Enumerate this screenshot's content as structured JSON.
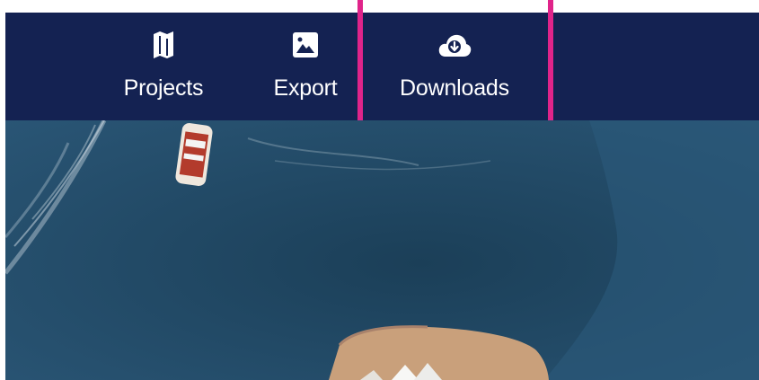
{
  "toolbar": {
    "items": [
      {
        "label": "Projects",
        "icon": "map-icon"
      },
      {
        "label": "Export",
        "icon": "image-icon"
      },
      {
        "label": "Downloads",
        "icon": "cloud-download-icon"
      }
    ],
    "highlighted_item": "Downloads"
  },
  "photo": {
    "subject": "aerial-harbour-view"
  },
  "colors": {
    "toolbar_bg": "#142252",
    "highlight_border": "#e0248a",
    "water": "#234c6b",
    "shore": "#c9a07b"
  }
}
